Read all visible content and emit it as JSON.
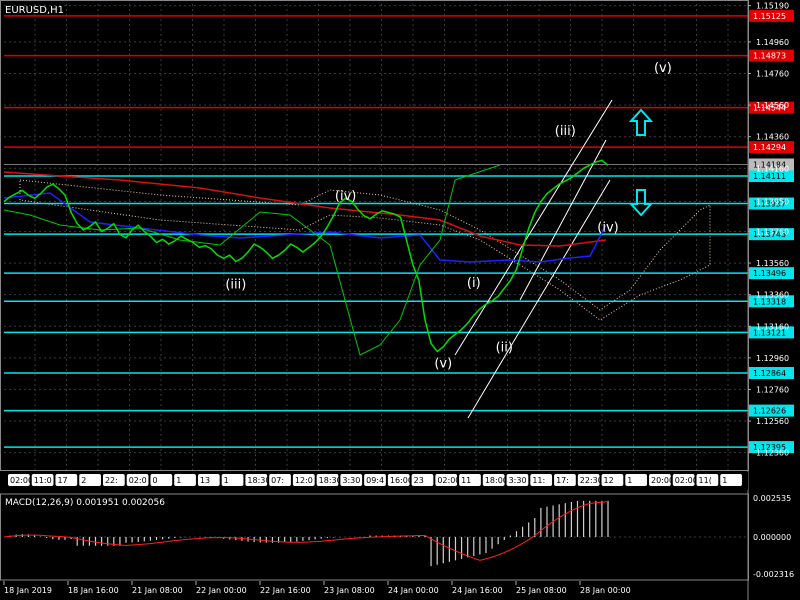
{
  "chart_title": "EURUSD,H1",
  "macd_label": "MACD(12,26,9) 0.001951 0.002056",
  "colors": {
    "background": "#000000",
    "grid": "#3a3a3a",
    "price": "#00e000",
    "red_level": "#e00000",
    "cyan_level": "#00e5ee",
    "ma_red": "#d81010",
    "ma_blue": "#2020ff",
    "cloud": "#f5c8a8",
    "macd_bar": "#d0d0d0",
    "macd_signal": "#ff2020",
    "text": "#ffffff"
  },
  "price_axis": {
    "min": 1.1225,
    "max": 1.152,
    "ticks": [
      "1.15190",
      "1.14960",
      "1.14760",
      "1.14560",
      "1.14360",
      "1.14160",
      "1.13950",
      "1.13760",
      "1.13560",
      "1.13360",
      "1.13160",
      "1.12960",
      "1.12760",
      "1.12560",
      "1.12360"
    ]
  },
  "levels": {
    "red": [
      {
        "value": 1.15125,
        "label": "1.15125"
      },
      {
        "value": 1.14873,
        "label": "1.14873"
      },
      {
        "value": 1.14544,
        "label": "1.14544"
      },
      {
        "value": 1.14294,
        "label": "1.14294"
      }
    ],
    "cyan": [
      {
        "value": 1.14111,
        "label": "1.14111"
      },
      {
        "value": 1.13937,
        "label": "1.13937"
      },
      {
        "value": 1.13743,
        "label": "1.13743"
      },
      {
        "value": 1.13496,
        "label": "1.13496"
      },
      {
        "value": 1.13318,
        "label": "1.13318"
      },
      {
        "value": 1.13121,
        "label": "1.13121"
      },
      {
        "value": 1.12864,
        "label": "1.12864"
      },
      {
        "value": 1.12626,
        "label": "1.12626"
      },
      {
        "value": 1.12395,
        "label": "1.12395"
      }
    ],
    "current": {
      "value": 1.14184,
      "label": "1.14184"
    }
  },
  "wave_labels": [
    {
      "text": "(v)",
      "price": 1.1477,
      "bar": 108
    },
    {
      "text": "(iii)",
      "price": 1.1437,
      "bar": 92
    },
    {
      "text": "(iv)",
      "price": 1.1396,
      "bar": 56
    },
    {
      "text": "(iv)",
      "price": 1.1376,
      "bar": 99
    },
    {
      "text": "(iii)",
      "price": 1.134,
      "bar": 38
    },
    {
      "text": "(i)",
      "price": 1.1341,
      "bar": 77
    },
    {
      "text": "(ii)",
      "price": 1.13,
      "bar": 82
    },
    {
      "text": "(v)",
      "price": 1.129,
      "bar": 72
    }
  ],
  "time_strip_labels": [
    "02:00",
    "11:0",
    "17",
    "2",
    "22:",
    "02:0",
    "0",
    "1",
    "13",
    "1",
    "18:30",
    "07:",
    "12:0",
    "18:30",
    "3:30",
    "09:4",
    "16:00",
    "23",
    "02:00",
    "11",
    "18:00",
    "3:30",
    "11:",
    "17:",
    "22:30",
    "12",
    "1",
    "20:00",
    "02:00",
    "11(",
    "1"
  ],
  "macd_axis": {
    "ticks": [
      "0.002535",
      "0.000000",
      "-0.002316"
    ]
  },
  "time_axis": [
    "18 Jan 2019",
    "18 Jan 16:00",
    "21 Jan 08:00",
    "22 Jan 00:00",
    "22 Jan 16:00",
    "23 Jan 08:00",
    "24 Jan 00:00",
    "24 Jan 16:00",
    "25 Jan 08:00",
    "28 Jan 00:00"
  ],
  "chart_data": {
    "type": "line",
    "title": "EURUSD,H1",
    "series": [
      {
        "name": "EURUSD,H1",
        "values": [
          1.1395,
          1.1398,
          1.14,
          1.1402,
          1.1399,
          1.1397,
          1.14,
          1.1404,
          1.1406,
          1.1403,
          1.1399,
          1.1388,
          1.1381,
          1.1377,
          1.1379,
          1.1382,
          1.1376,
          1.1378,
          1.1381,
          1.1374,
          1.1372,
          1.1377,
          1.138,
          1.1376,
          1.1373,
          1.1369,
          1.1371,
          1.1368,
          1.137,
          1.1373,
          1.1371,
          1.1369,
          1.1366,
          1.1367,
          1.1365,
          1.1361,
          1.1359,
          1.1361,
          1.1357,
          1.1359,
          1.1363,
          1.1368,
          1.1366,
          1.1363,
          1.1359,
          1.1361,
          1.1364,
          1.1368,
          1.1366,
          1.1363,
          1.1366,
          1.1369,
          1.1373,
          1.1379,
          1.1386,
          1.1394,
          1.1397,
          1.1395,
          1.139,
          1.1386,
          1.1384,
          1.1387,
          1.1389,
          1.1388,
          1.1387,
          1.1385,
          1.137,
          1.1355,
          1.1345,
          1.132,
          1.1305,
          1.13,
          1.1303,
          1.1308,
          1.1311,
          1.1314,
          1.1318,
          1.1323,
          1.1327,
          1.133,
          1.1332,
          1.1335,
          1.134,
          1.1345,
          1.1352,
          1.1365,
          1.1378,
          1.1388,
          1.1395,
          1.14,
          1.1403,
          1.1406,
          1.1408,
          1.141,
          1.1413,
          1.1416,
          1.1418,
          1.142,
          1.1421,
          1.1418
        ]
      }
    ],
    "ylim": [
      1.1225,
      1.152
    ]
  }
}
